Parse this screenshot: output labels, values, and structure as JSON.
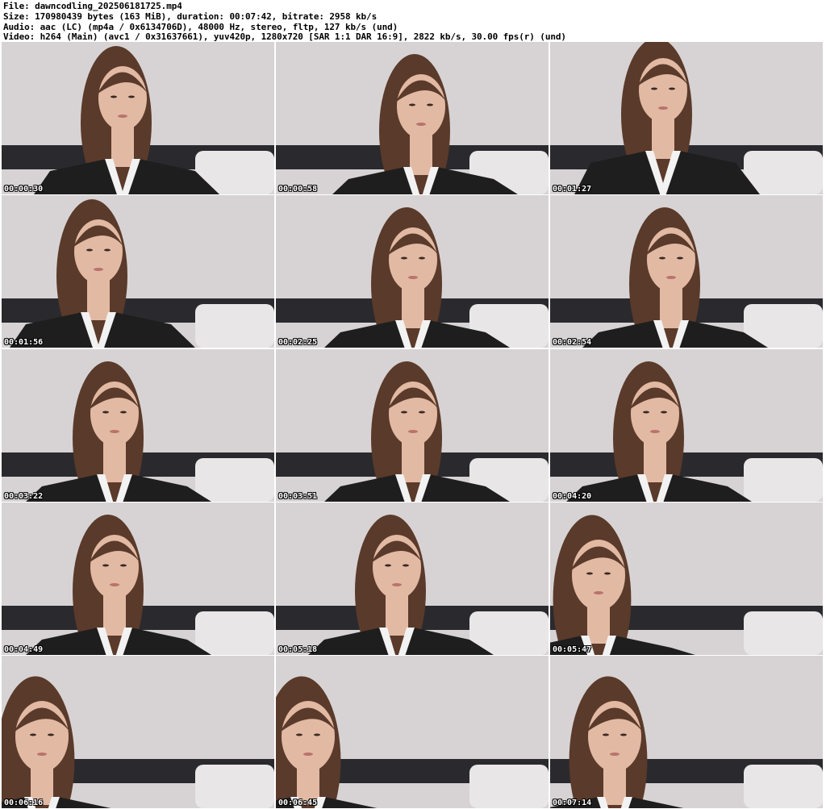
{
  "header": {
    "file_line": "File: dawncodling_202506181725.mp4",
    "size_line": "Size: 170980439 bytes (163 MiB), duration: 00:07:42, bitrate: 2958 kb/s",
    "audio_line": "Audio: aac (LC) (mp4a / 0x6134706D), 48000 Hz, stereo, fltp, 127 kb/s (und)",
    "video_line": "Video: h264 (Main) (avc1 / 0x31637661), yuv420p, 1280x720 [SAR 1:1 DAR 16:9], 2822 kb/s, 30.00 fps(r) (und)"
  },
  "thumbnails": [
    {
      "timestamp": "00:00:30"
    },
    {
      "timestamp": "00:00:58"
    },
    {
      "timestamp": "00:01:27"
    },
    {
      "timestamp": "00:01:56"
    },
    {
      "timestamp": "00:02:25"
    },
    {
      "timestamp": "00:02:54"
    },
    {
      "timestamp": "00:03:22"
    },
    {
      "timestamp": "00:03:51"
    },
    {
      "timestamp": "00:04:20"
    },
    {
      "timestamp": "00:04:49"
    },
    {
      "timestamp": "00:05:18"
    },
    {
      "timestamp": "00:05:47"
    },
    {
      "timestamp": "00:06:16"
    },
    {
      "timestamp": "00:06:45"
    },
    {
      "timestamp": "00:07:14"
    }
  ],
  "colors": {
    "wall": "#d7d3d4",
    "headboard": "#2a2a2e",
    "pillow": "#e8e6e7",
    "skin": "#e2b9a3",
    "hair": "#5a3a2a",
    "cardigan_light": "#f2f2f2",
    "cardigan_dark": "#1e1e1e"
  }
}
